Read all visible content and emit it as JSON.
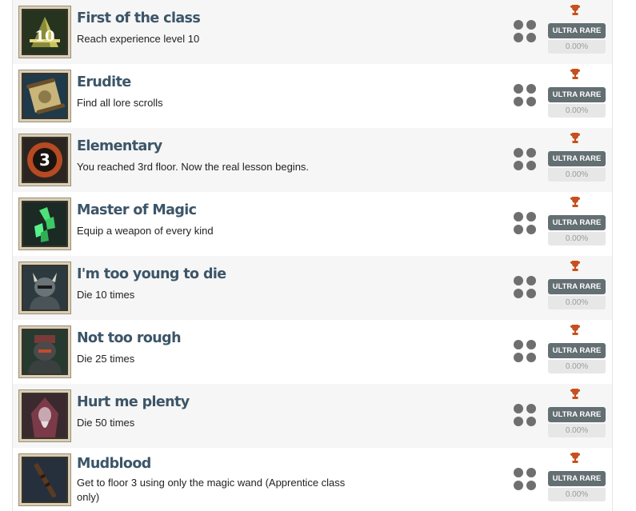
{
  "achievements": [
    {
      "title": "First of the class",
      "description": "Reach experience level 10",
      "rarity": "ULTRA RARE",
      "percent": "0.00%",
      "icon": "level-10-icon"
    },
    {
      "title": "Erudite",
      "description": "Find all lore scrolls",
      "rarity": "ULTRA RARE",
      "percent": "0.00%",
      "icon": "scroll-icon"
    },
    {
      "title": "Elementary",
      "description": "You reached 3rd floor. Now the real lesson begins.",
      "rarity": "ULTRA RARE",
      "percent": "0.00%",
      "icon": "floor-3-icon",
      "badge_text": "3"
    },
    {
      "title": "Master of Magic",
      "description": "Equip a weapon of every kind",
      "rarity": "ULTRA RARE",
      "percent": "0.00%",
      "icon": "green-crystal-icon"
    },
    {
      "title": "I'm too young to die",
      "description": "Die 10 times",
      "rarity": "ULTRA RARE",
      "percent": "0.00%",
      "icon": "horned-knight-icon"
    },
    {
      "title": "Not too rough",
      "description": "Die 25 times",
      "rarity": "ULTRA RARE",
      "percent": "0.00%",
      "icon": "armored-knight-icon"
    },
    {
      "title": "Hurt me plenty",
      "description": "Die 50 times",
      "rarity": "ULTRA RARE",
      "percent": "0.00%",
      "icon": "hooded-mage-icon"
    },
    {
      "title": "Mudblood",
      "description": "Get to floor 3 using only the magic wand (Apprentice class only)",
      "rarity": "ULTRA RARE",
      "percent": "0.00%",
      "icon": "magic-wand-icon"
    }
  ],
  "level_badge_text": "10",
  "colors": {
    "title": "#3c5568",
    "trophy": "#c8501e",
    "rarity_bg": "#636f73",
    "row_alt": "#f6f6f6"
  }
}
